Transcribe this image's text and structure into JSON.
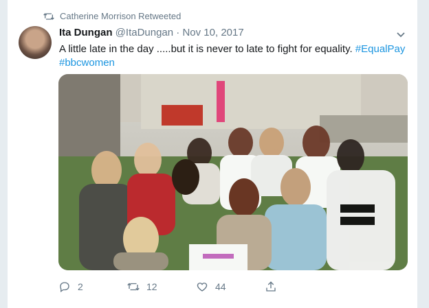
{
  "retweet": {
    "text": "Catherine Morrison Retweeted"
  },
  "tweet": {
    "name": "Ita Dungan",
    "handle": "@ItaDungan",
    "separator": "·",
    "date": "Nov 10, 2017",
    "text": "A little late in the day .....but it is never to late to fight for equality.",
    "hashtags": [
      "#EqualPay",
      "#bbcwomen"
    ]
  },
  "actions": {
    "replies": "2",
    "retweets": "12",
    "likes": "44"
  },
  "icons": {
    "retweet": "retweet-icon",
    "reply": "reply-icon",
    "like": "heart-icon",
    "share": "share-icon",
    "menu": "chevron-down-icon"
  },
  "colors": {
    "accent": "#1b95e0",
    "muted": "#657786"
  }
}
